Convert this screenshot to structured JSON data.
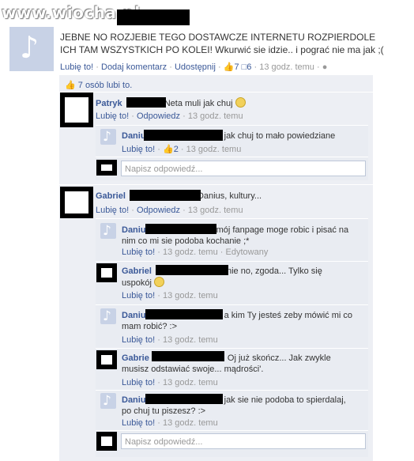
{
  "watermark": "www.wiocha.pl",
  "post": {
    "text": "JEBNE NO ROZJEBIE TEGO DOSTAWCZE INTERNETU ROZPIERDOLE ICH TAM WSZYSTKICH PO KOLEI! Wkurwić sie idzie.. i pograć nie ma jak ;(",
    "actions": {
      "like": "Lubię to!",
      "sep1": "·",
      "comment": "Dodaj komentarz",
      "sep2": "·",
      "share": "Udostępnij",
      "sep3": "·",
      "likes_count": "7",
      "comments_count": "6",
      "sep4": "·",
      "time": "13 godz. temu",
      "sep5": "·"
    }
  },
  "likes_summary": "7 osób lubi to.",
  "threads": [
    {
      "name": "Patryk",
      "text": "Neta muli jak chuj",
      "like": "Lubię to!",
      "sep1": "·",
      "reply": "Odpowiedz",
      "sep2": "·",
      "time": "13 godz. temu",
      "replies": [
        {
          "name": "Daniu",
          "text": "jak chuj to mało powiedziane",
          "like": "Lubię to!",
          "sep1": "·",
          "likes": "2",
          "sep2": "·",
          "time": "13 godz. temu"
        }
      ],
      "reply_placeholder": "Napisz odpowiedź..."
    },
    {
      "name": "Gabriel",
      "text": "Danius, kultury...",
      "like": "Lubię to!",
      "sep1": "·",
      "reply": "Odpowiedz",
      "sep2": "·",
      "time": "13 godz. temu",
      "replies": [
        {
          "name": "Daniu",
          "text_line1": "mój fanpage moge robic i pisać na",
          "text_line2": "nim co mi sie podoba kochanie ;*",
          "like": "Lubię to!",
          "sep1": "·",
          "time": "13 godz. temu",
          "sep2": "·",
          "edited": "Edytowany"
        },
        {
          "name": "Gabriel",
          "text_line1": "nie no, zgoda... Tylko się",
          "text_line2": "uspokój",
          "like": "Lubię to!",
          "sep1": "·",
          "time": "13 godz. temu"
        },
        {
          "name": "Daniu",
          "text_line1": "a kim Ty jesteś zeby mówić mi co",
          "text_line2": "mam robić? :>",
          "like": "Lubię to!",
          "sep1": "·",
          "time": "13 godz. temu"
        },
        {
          "name": "Gabrie",
          "text_line1": "Oj już skończ... Jak zwykle",
          "text_line2": "musisz odstawiać swoje... mądrości'.",
          "like": "Lubię to!",
          "sep1": "·",
          "time": "13 godz. temu"
        },
        {
          "name": "Daniu",
          "text_line1": "jak sie nie podoba to spierdalaj,",
          "text_line2": "po chuj tu piszesz? :>",
          "like": "Lubię to!",
          "sep1": "·",
          "time": "13 godz. temu"
        }
      ],
      "reply_placeholder": "Napisz odpowiedź..."
    }
  ],
  "colors": {
    "link": "#3b5998",
    "panel": "#edeff4",
    "meta": "#999999"
  }
}
